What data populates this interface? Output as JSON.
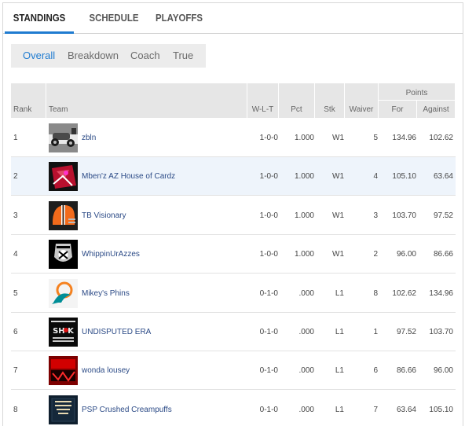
{
  "tabs": [
    "STANDINGS",
    "SCHEDULE",
    "PLAYOFFS"
  ],
  "subtabs": [
    "Overall",
    "Breakdown",
    "Coach",
    "True"
  ],
  "table": {
    "points_group": "Points",
    "headers": {
      "rank": "Rank",
      "team": "Team",
      "wlt": "W-L-T",
      "pct": "Pct",
      "stk": "Stk",
      "waiver": "Waiver",
      "for": "For",
      "against": "Against"
    },
    "rows": [
      {
        "rank": "1",
        "team": "zbln",
        "wlt": "1-0-0",
        "pct": "1.000",
        "stk": "W1",
        "waiver": "5",
        "for": "134.96",
        "against": "102.62",
        "avatar": "race-car-logo"
      },
      {
        "rank": "2",
        "team": "Mben'z AZ House of Cardz",
        "wlt": "1-0-0",
        "pct": "1.000",
        "stk": "W1",
        "waiver": "4",
        "for": "105.10",
        "against": "63.64",
        "avatar": "cardinals-logo"
      },
      {
        "rank": "3",
        "team": "TB Visionary",
        "wlt": "1-0-0",
        "pct": "1.000",
        "stk": "W1",
        "waiver": "3",
        "for": "103.70",
        "against": "97.52",
        "avatar": "browns-helmet-logo"
      },
      {
        "rank": "4",
        "team": "WhippinUrAzzes",
        "wlt": "1-0-0",
        "pct": "1.000",
        "stk": "W1",
        "waiver": "2",
        "for": "96.00",
        "against": "86.66",
        "avatar": "raiders-shield-logo"
      },
      {
        "rank": "5",
        "team": "Mikey's Phins",
        "wlt": "0-1-0",
        "pct": ".000",
        "stk": "L1",
        "waiver": "8",
        "for": "102.62",
        "against": "134.96",
        "avatar": "dolphins-logo"
      },
      {
        "rank": "6",
        "team": "UNDISPUTED ERA",
        "wlt": "0-1-0",
        "pct": ".000",
        "stk": "L1",
        "waiver": "1",
        "for": "97.52",
        "against": "103.70",
        "avatar": "shock-the-system-logo"
      },
      {
        "rank": "7",
        "team": "wonda lousey",
        "wlt": "0-1-0",
        "pct": ".000",
        "stk": "L1",
        "waiver": "6",
        "for": "86.66",
        "against": "96.00",
        "avatar": "red-graffiti-logo"
      },
      {
        "rank": "8",
        "team": "PSP Crushed Creampuffs",
        "wlt": "0-1-0",
        "pct": ".000",
        "stk": "L1",
        "waiver": "7",
        "for": "63.64",
        "against": "105.10",
        "avatar": "you-matter-logo"
      }
    ]
  },
  "colors": {
    "accent": "#1f7bd0",
    "header_bg": "#e6e6e6",
    "alt_row": "#eef4fb",
    "link": "#2b4a86"
  }
}
